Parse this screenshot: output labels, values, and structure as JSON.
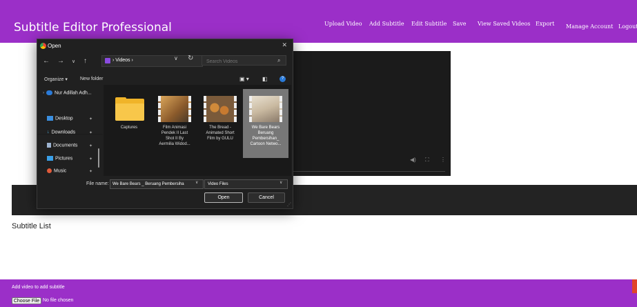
{
  "app": {
    "title": "Subtitle Editor Professional",
    "accent": "#9b2fc8",
    "nav": [
      "Upload Video",
      "Add Subtitle",
      "Edit Subtitle",
      "Save",
      "View Saved Videos",
      "Export",
      "Manage Account",
      "Logout"
    ]
  },
  "main": {
    "subtitle_list_heading": "Subtitle List",
    "video_controls": [
      "volume-icon",
      "fullscreen-icon",
      "more-icon"
    ]
  },
  "footer": {
    "hint": "Add video to add subtitle",
    "choose_file": "Choose File",
    "no_file": "No file chosen"
  },
  "dialog": {
    "title": "Open",
    "address_path": "› Videos ›",
    "search_placeholder": "Search Videos",
    "organize": "Organize ▾",
    "new_folder": "New folder",
    "sidebar": [
      "Nur Adillah Adh...",
      "Desktop",
      "Downloads",
      "Documents",
      "Pictures",
      "Music"
    ],
    "files": [
      {
        "name": "Captures"
      },
      {
        "name": "Film Animasi\nPendek II Last\nShot II By\nAermilia Widod..."
      },
      {
        "name": "The Bread -\nAnimated Short\nFilm by GULU"
      },
      {
        "name": "We Bare Bears\nBeruang\nPembersihan_\nCartoon Netwo...",
        "selected": true
      }
    ],
    "file_name_label": "File name:",
    "file_name_value": "We Bare Bears _ Beruang Pembersiha",
    "file_type": "Video Files",
    "open_button": "Open",
    "cancel_button": "Cancel"
  }
}
